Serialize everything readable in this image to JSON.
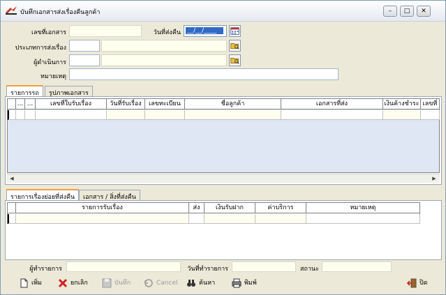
{
  "window": {
    "title": "บันทึกเอกสารส่งเรื่องคืนลูกค้า",
    "controls": {
      "minimize": "–",
      "maximize": "□",
      "close": "✕"
    }
  },
  "form": {
    "doc_no_label": "เลขที่เอกสาร",
    "doc_no_value": "",
    "return_date_label": "วันที่ส่งคืน",
    "return_date_value": "__/__/____",
    "send_type_label": "ประเภทการส่งเรื่อง",
    "send_type_code": "",
    "send_type_name": "",
    "operator_label": "ผู้ดำเนินการ",
    "operator_code": "",
    "operator_name": "",
    "remark_label": "หมายเหตุ",
    "remark_value": ""
  },
  "upper_tabs": [
    "รายการรถ",
    "รูปภาพเอกสาร"
  ],
  "upper_grid": {
    "columns": [
      "...",
      "...",
      "เลขที่ใบรับเรื่อง",
      "วันที่รับเรื่อง",
      "เลขทะเบียน",
      "ชื่อลูกค้า",
      "เอกสารที่ส่ง",
      "เงินค้างชำระ",
      "เลขที่"
    ]
  },
  "lower_tabs": [
    "รายการเรื่องย่อยที่ส่งคืน",
    "เอกสาร / สิ่งที่ส่งคืน"
  ],
  "lower_grid": {
    "columns": [
      "รายการรับเรื่อง",
      "ส่ง",
      "เงินรับฝาก",
      "ค่าบริการ",
      "หมายเหตุ"
    ]
  },
  "footer_info": {
    "recorder_label": "ผู้ทำรายการ",
    "recorder_value": "",
    "record_date_label": "วันที่ทำรายการ",
    "record_date_value": "",
    "status_label": "สถานะ",
    "status_value": ""
  },
  "toolbar": {
    "add": "เพิ่ม",
    "cancel_th": "ยกเลิก",
    "save": "บันทึก",
    "cancel_en": "Cancel",
    "search": "ค้นหา",
    "print": "พิมพ์",
    "close": "ปิด"
  }
}
